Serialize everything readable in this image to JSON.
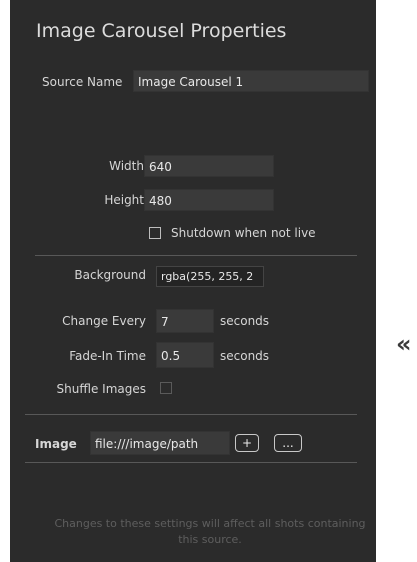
{
  "panel": {
    "title": "Image Carousel Properties",
    "source_name": {
      "label": "Source Name",
      "value": "Image Carousel 1"
    },
    "width": {
      "label": "Width",
      "value": "640"
    },
    "height": {
      "label": "Height",
      "value": "480"
    },
    "shutdown": {
      "label": "Shutdown when not live",
      "checked": false
    },
    "background": {
      "label": "Background",
      "value": "rgba(255, 255, 2"
    },
    "change_every": {
      "label": "Change Every",
      "value": "7",
      "unit": "seconds"
    },
    "fade_in": {
      "label": "Fade-In Time",
      "value": "0.5",
      "unit": "seconds"
    },
    "shuffle": {
      "label": "Shuffle Images",
      "checked": false
    },
    "image": {
      "label": "Image",
      "value": "file:///image/path",
      "add_label": "+",
      "more_label": "..."
    },
    "footer": "Changes to these settings will affect all shots containing this source."
  },
  "collapse_icon": "«",
  "colors": {
    "panel_bg": "#2b2b2b",
    "field_bg": "#3a3a3a",
    "text": "#d6d6d6",
    "muted_text": "#5e5e5e"
  }
}
